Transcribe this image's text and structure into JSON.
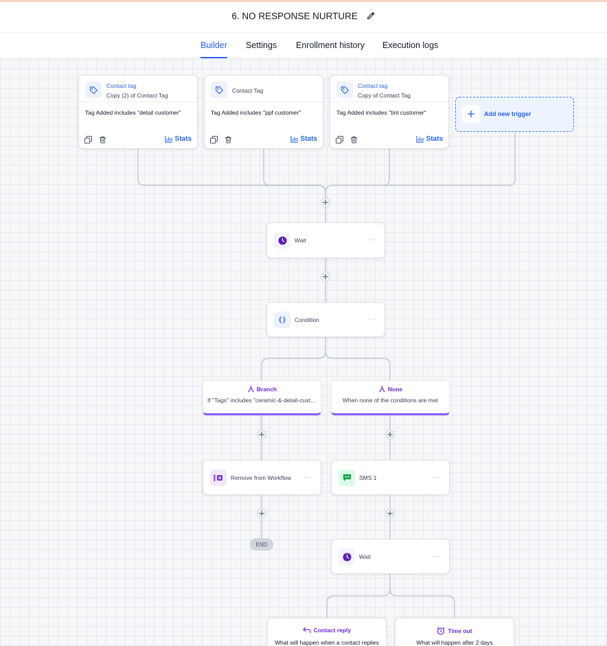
{
  "header": {
    "title": "6. NO RESPONSE NURTURE"
  },
  "tabs": [
    {
      "label": "Builder",
      "active": true
    },
    {
      "label": "Settings",
      "active": false
    },
    {
      "label": "Enrollment history",
      "active": false
    },
    {
      "label": "Execution logs",
      "active": false
    }
  ],
  "triggers": [
    {
      "title": "Contact tag",
      "subtitle": "Copy (2) of Contact Tag",
      "description": "Tag Added includes \"detail customer\"",
      "stats_label": "Stats"
    },
    {
      "title": "",
      "subtitle": "Contact Tag",
      "description": "Tag Added includes \"ppf customer\"",
      "stats_label": "Stats"
    },
    {
      "title": "Contact tag",
      "subtitle": "Copy of Contact Tag",
      "description": "Tag Added includes \"tint customer\"",
      "stats_label": "Stats"
    }
  ],
  "add_trigger": {
    "label": "Add new trigger"
  },
  "actions": {
    "wait1": {
      "label": "Wait",
      "more": "···"
    },
    "condition": {
      "label": "Condition",
      "more": "···"
    },
    "remove": {
      "label": "Remove from Workflow",
      "more": "···"
    },
    "sms": {
      "label": "SMS 1",
      "more": "···"
    },
    "wait2": {
      "label": "Wait",
      "more": "···"
    }
  },
  "branches": [
    {
      "title": "Branch",
      "description": "If \"Tags\" includes \"ceramic-&-detail-customer\""
    },
    {
      "title": "None",
      "description": "When none of the conditions are met"
    }
  ],
  "end_label": "END",
  "outcomes": [
    {
      "title": "Contact reply",
      "description": "What will happen when a contact replies"
    },
    {
      "title": "Time out",
      "description": "What will happen after 2 days"
    }
  ],
  "colors": {
    "accent": "#2563eb",
    "branch": "#8b5cf6",
    "wait_icon": "#5b21b6",
    "sms_icon": "#16a34a"
  }
}
